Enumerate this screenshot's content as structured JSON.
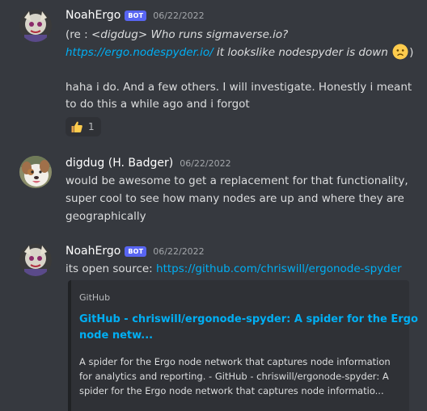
{
  "messages": [
    {
      "author": "NoahErgo",
      "bot_tag": "BOT",
      "timestamp": "06/22/2022",
      "line1": {
        "prefix": "(re  : ",
        "quote": "<digdug> Who runs sigmaverse.io?"
      },
      "line2": {
        "link": "https://ergo.nodespyder.io/",
        "after_link": " it lookslike nodespyder is down",
        "close": ")"
      },
      "body_line1": "haha i do. And a few others. I will investigate. Honestly i meant",
      "body_line2": "to do this a while ago and i forgot",
      "reaction": {
        "emoji": "thumbs-up-icon",
        "count": "1"
      }
    },
    {
      "author": "digdug (H. Badger)",
      "timestamp": "06/22/2022",
      "line1": "would be awesome to get a replacement for that functionality,",
      "line2": "super cool to see how many nodes are up and where they are",
      "line3": "geographically"
    },
    {
      "author": "NoahErgo",
      "bot_tag": "BOT",
      "timestamp": "06/22/2022",
      "prefix": "its open source: ",
      "link": "https://github.com/chriswill/ergonode-spyder",
      "embed": {
        "provider": "GitHub",
        "title_line1": "GitHub - chriswill/ergonode-spyder: A spider for the Ergo",
        "title_line2": "node netw...",
        "desc_line1": "A spider for the Ergo node network that captures node information",
        "desc_line2": "for analytics and reporting. - GitHub - chriswill/ergonode-spyder: A",
        "desc_line3": "spider for the Ergo node network that captures node informatio..."
      }
    }
  ],
  "colors": {
    "background": "#36393f",
    "link": "#00aff4",
    "bot_tag": "#5865f2",
    "embed_bg": "#2f3136",
    "text": "#dcddde",
    "timestamp": "#a3a6aa"
  }
}
